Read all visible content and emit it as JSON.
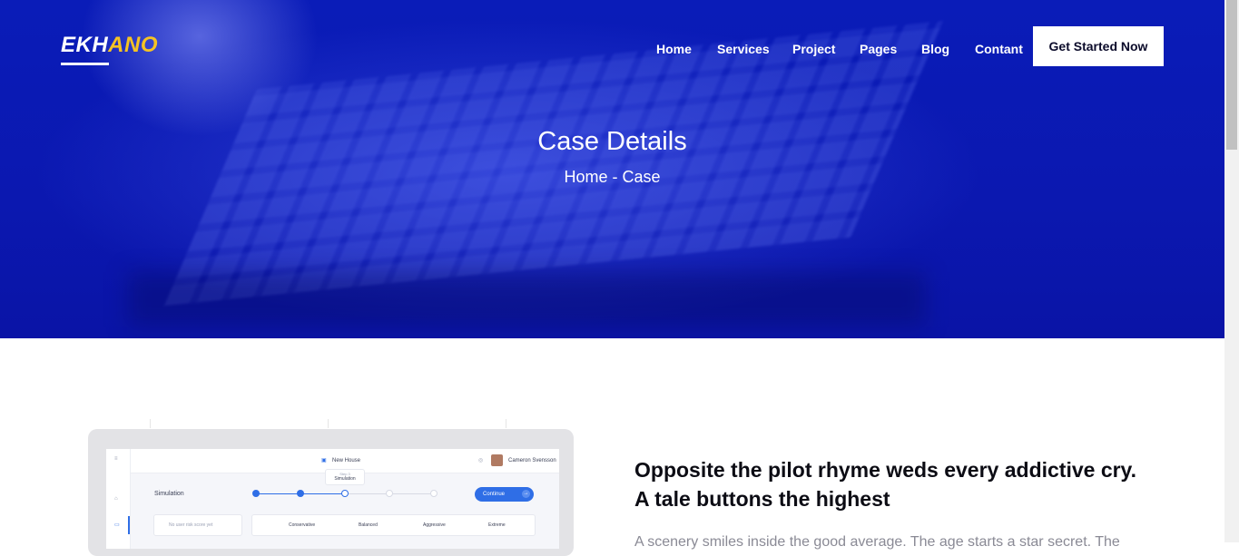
{
  "header": {
    "logo_part1": "EKH",
    "logo_part2": "ANO",
    "nav": [
      "Home",
      "Services",
      "Project",
      "Pages",
      "Blog",
      "Contant"
    ],
    "cta_label": "Get Started Now"
  },
  "hero": {
    "title": "Case Details",
    "breadcrumb": "Home - Case"
  },
  "mockup": {
    "top_label": "New House",
    "step_label": "Step 3",
    "step_name": "Simulation",
    "user_name": "Cameron Svensson",
    "section_label": "Simulation",
    "continue_label": "Continue",
    "risk_placeholder": "No user risk score yet",
    "options": [
      "Conservative",
      "Balanced",
      "Aggressive",
      "Extreme"
    ]
  },
  "content": {
    "heading": "Opposite the pilot rhyme weds every addictive cry. A tale buttons the highest",
    "paragraph": "A scenery smiles inside the good average. The age starts a star secret. The"
  },
  "colors": {
    "hero_blue": "#0b18b0",
    "accent_yellow": "#f5c323",
    "mock_button": "#2f6ee6"
  }
}
